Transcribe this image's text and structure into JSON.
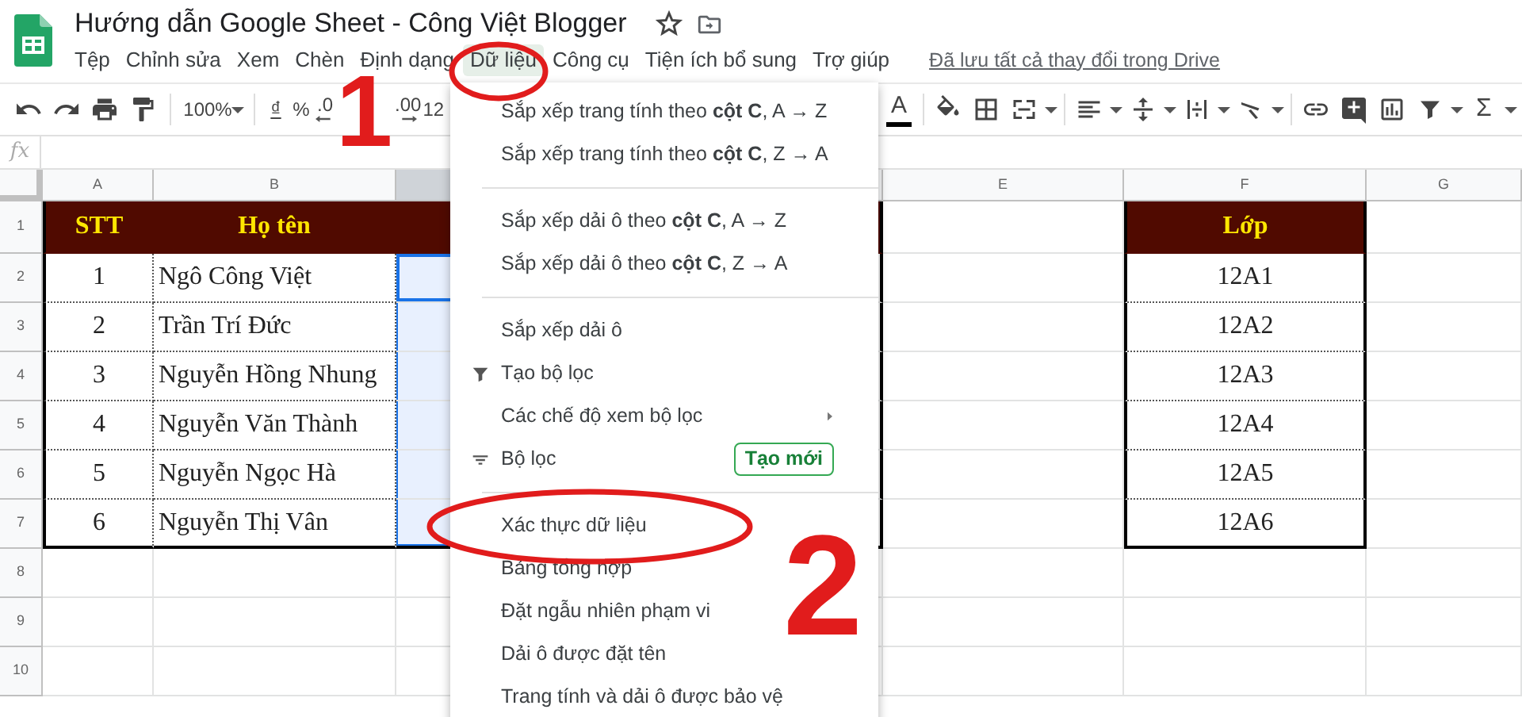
{
  "title": "Hướng dẫn Google Sheet - Công Việt Blogger",
  "menu_bar": [
    {
      "label": "Tệp",
      "selected": false
    },
    {
      "label": "Chỉnh sửa",
      "selected": false
    },
    {
      "label": "Xem",
      "selected": false
    },
    {
      "label": "Chèn",
      "selected": false
    },
    {
      "label": "Định dạng",
      "selected": false
    },
    {
      "label": "Dữ liệu",
      "selected": true
    },
    {
      "label": "Công cụ",
      "selected": false
    },
    {
      "label": "Tiện ích bổ sung",
      "selected": false
    },
    {
      "label": "Trợ giúp",
      "selected": false
    }
  ],
  "save_status": "Đã lưu tất cả thay đổi trong Drive",
  "toolbar": {
    "zoom": "100%",
    "currency": "₫",
    "percent": "%",
    "decrease_decimals": ".0",
    "increase_decimals": ".00",
    "more_formats": "12",
    "text_color": "A",
    "functions": "Σ"
  },
  "formula_bar": {
    "label": "fx"
  },
  "columns": [
    {
      "label": "A",
      "selected": false
    },
    {
      "label": "B",
      "selected": false
    },
    {
      "selected": true
    },
    {
      "selected": false
    },
    {
      "label": "E",
      "selected": false
    },
    {
      "label": "F",
      "selected": false
    },
    {
      "label": "G",
      "selected": false
    }
  ],
  "row_numbers": [
    "1",
    "2",
    "3",
    "4",
    "5",
    "6",
    "7",
    "8",
    "9",
    "10"
  ],
  "student_table": {
    "header": {
      "stt": "STT",
      "name": "Họ tên"
    },
    "rows": [
      {
        "stt": "1",
        "name": "Ngô Công Việt",
        "selected": true,
        "active": true
      },
      {
        "stt": "2",
        "name": "Trần Trí Đức",
        "selected": true,
        "active": false
      },
      {
        "stt": "3",
        "name": "Nguyễn Hồng Nhung",
        "selected": true,
        "active": false
      },
      {
        "stt": "4",
        "name": "Nguyễn Văn Thành",
        "selected": true,
        "active": false
      },
      {
        "stt": "5",
        "name": "Nguyễn Ngọc Hà",
        "selected": true,
        "active": false
      },
      {
        "stt": "6",
        "name": "Nguyễn Thị Vân",
        "selected": true,
        "active": false
      }
    ]
  },
  "class_table": {
    "header": "Lớp",
    "rows": [
      "12A1",
      "12A2",
      "12A3",
      "12A4",
      "12A5",
      "12A6"
    ]
  },
  "data_menu": [
    {
      "kind": "plain",
      "label": "Sắp xếp trang tính theo **cột C**, A → Z"
    },
    {
      "kind": "plain",
      "label": "Sắp xếp trang tính theo **cột C**, Z → A"
    },
    {
      "kind": "separator"
    },
    {
      "kind": "plain",
      "label": "Sắp xếp dải ô theo **cột C**, A → Z"
    },
    {
      "kind": "plain",
      "label": "Sắp xếp dải ô theo **cột C**, Z → A"
    },
    {
      "kind": "separator"
    },
    {
      "kind": "plain",
      "label": "Sắp xếp dải ô"
    },
    {
      "kind": "funnel",
      "label": "Tạo bộ lọc"
    },
    {
      "kind": "submenu",
      "label": "Các chế độ xem bộ lọc"
    },
    {
      "kind": "filter",
      "label": "Bộ lọc",
      "action": "Tạo mới"
    },
    {
      "kind": "separator"
    },
    {
      "kind": "plain",
      "label": "Xác thực dữ liệu"
    },
    {
      "kind": "plain",
      "label": "Bảng tổng hợp"
    },
    {
      "kind": "plain",
      "label": "Đặt ngẫu nhiên phạm vi"
    },
    {
      "kind": "plain",
      "label": "Dải ô được đặt tên"
    },
    {
      "kind": "plain",
      "label": "Trang tính và dải ô được bảo vệ"
    }
  ],
  "annotations": [
    {
      "kind": "number",
      "text": "1"
    },
    {
      "kind": "ellipse"
    },
    {
      "kind": "ellipse"
    },
    {
      "kind": "number",
      "text": "2"
    }
  ]
}
